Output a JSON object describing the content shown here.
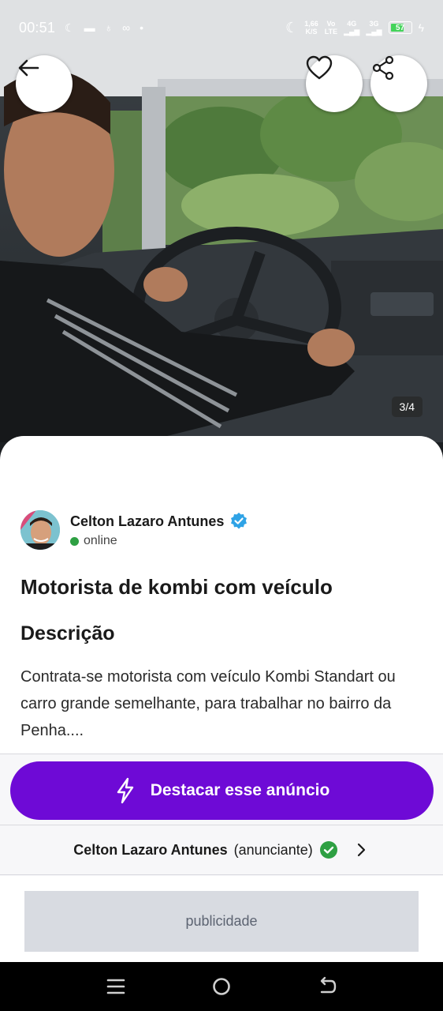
{
  "status_bar": {
    "time": "00:51",
    "speed_value": "1,66",
    "speed_unit": "K/S",
    "net_a_top": "Vo",
    "net_a_bottom": "LTE",
    "net_b": "4G",
    "net_c": "3G",
    "battery": "57",
    "left_icons": [
      "moon-icon",
      "bed-icon",
      "moneybag-icon",
      "voicemail-icon",
      "dot-icon"
    ]
  },
  "hero": {
    "image_counter": "3/4",
    "back_icon": "back-arrow-icon",
    "favorite_icon": "heart-icon",
    "share_icon": "share-icon"
  },
  "seller": {
    "name": "Celton Lazaro Antunes",
    "status": "online",
    "verified_icon": "verified-badge-icon"
  },
  "listing": {
    "title": "Motorista de kombi com veículo",
    "section_title": "Descrição",
    "description": "Contrata-se motorista com veículo Kombi Standart ou carro grande semelhante, para trabalhar no bairro da Penha...."
  },
  "actions": {
    "highlight_label": "Destacar esse anúncio",
    "highlight_icon": "lightning-icon",
    "advertiser_name": "Celton Lazaro Antunes",
    "advertiser_role": "(anunciante)",
    "ad_label": "publicidade"
  },
  "navbar": {
    "icons": [
      "menu-icon",
      "home-icon",
      "back-icon"
    ]
  },
  "colors": {
    "brand_purple": "#6e0ad6",
    "online_green": "#2ea043",
    "verified_blue": "#2fa3e6"
  }
}
